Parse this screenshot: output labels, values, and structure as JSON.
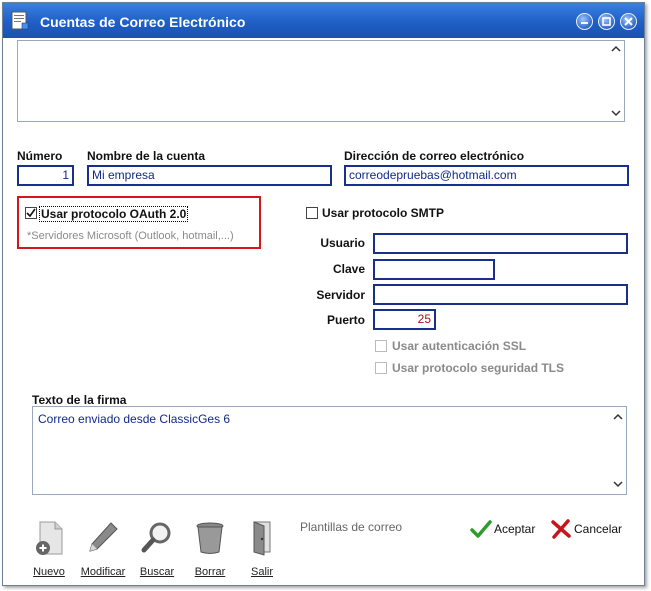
{
  "window": {
    "title": "Cuentas de Correo Electrónico"
  },
  "labels": {
    "numero": "Número",
    "nombre_cuenta": "Nombre de la cuenta",
    "direccion": "Dirección de correo electrónico",
    "usuario": "Usuario",
    "clave": "Clave",
    "servidor": "Servidor",
    "puerto": "Puerto",
    "firma": "Texto de la firma"
  },
  "fields": {
    "numero": "1",
    "nombre_cuenta": "Mi empresa",
    "direccion": "correodepruebas@hotmail.com",
    "usuario": "",
    "clave": "",
    "servidor": "",
    "puerto": "25",
    "firma": "Correo enviado desde ClassicGes 6"
  },
  "checkboxes": {
    "oauth": {
      "label": "Usar protocolo OAuth 2.0",
      "checked": true
    },
    "oauth_hint": "*Servidores Microsoft (Outlook, hotmail,...)",
    "smtp": {
      "label": "Usar protocolo SMTP",
      "checked": false
    },
    "ssl": {
      "label": "Usar autenticación SSL",
      "checked": false,
      "enabled": false
    },
    "tls": {
      "label": "Usar protocolo seguridad TLS",
      "checked": false,
      "enabled": false
    }
  },
  "toolbar": {
    "nuevo": "Nuevo",
    "modificar": "Modificar",
    "buscar": "Buscar",
    "borrar": "Borrar",
    "salir": "Salir"
  },
  "plantillas": "Plantillas de correo",
  "actions": {
    "aceptar": "Aceptar",
    "cancelar": "Cancelar"
  },
  "colors": {
    "titlebar": "#1f5fc7",
    "field_border": "#1a2f8c",
    "highlight": "#d61717",
    "accept": "#2e9c2e",
    "cancel": "#c8151b"
  }
}
